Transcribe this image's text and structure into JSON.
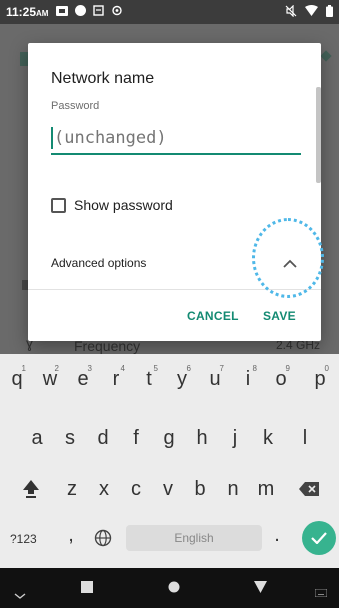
{
  "status_bar": {
    "time": "11:25",
    "ampm": "AM"
  },
  "background": {
    "frequency_label": "Frequency",
    "frequency_value": "2.4 GHz"
  },
  "dialog": {
    "title": "Network name",
    "password_label": "Password",
    "password_value": "(unchanged)",
    "show_password_label": "Show password",
    "show_password_checked": false,
    "advanced_options_label": "Advanced options",
    "cancel_label": "CANCEL",
    "save_label": "SAVE"
  },
  "keyboard": {
    "row1": [
      {
        "key": "q",
        "hint": "1"
      },
      {
        "key": "w",
        "hint": "2"
      },
      {
        "key": "e",
        "hint": "3"
      },
      {
        "key": "r",
        "hint": "4"
      },
      {
        "key": "t",
        "hint": "5"
      },
      {
        "key": "y",
        "hint": "6"
      },
      {
        "key": "u",
        "hint": "7"
      },
      {
        "key": "i",
        "hint": "8"
      },
      {
        "key": "o",
        "hint": "9"
      },
      {
        "key": "p",
        "hint": "0"
      }
    ],
    "row2": [
      "a",
      "s",
      "d",
      "f",
      "g",
      "h",
      "j",
      "k",
      "l"
    ],
    "row3": [
      "z",
      "x",
      "c",
      "v",
      "b",
      "n",
      "m"
    ],
    "symbols_label": "?123",
    "comma": ",",
    "period": ".",
    "space_label": "English"
  },
  "colors": {
    "accent": "#138a72",
    "enter_key": "#37b38f",
    "highlight": "#4fb8e8"
  }
}
